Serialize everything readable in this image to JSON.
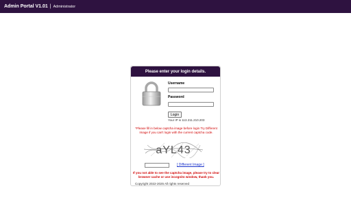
{
  "header": {
    "app_title": "Admin Portal V1.01",
    "separator": "|",
    "role": "Administrator"
  },
  "login": {
    "heading": "Please enter your login details.",
    "username_label": "Username",
    "username_value": "",
    "password_label": "Password",
    "password_value": "",
    "login_button": "Login",
    "ip_text": "Your IP is 113.211.210.203",
    "captcha_instructions": "*Please fill in below captcha image before login Try Different Image if you can't login with the current captcha code.",
    "captcha_text": "aYL43",
    "captcha_input_value": "",
    "different_image_link": "[ Different Image ]",
    "captcha_warning": "If you not able to see the captcha image, please try to clear browser cache or use incognito window, thank you.",
    "copyright": "Copyright 2022-2025 All rights reserved",
    "lock_icon": "padlock-icon"
  }
}
